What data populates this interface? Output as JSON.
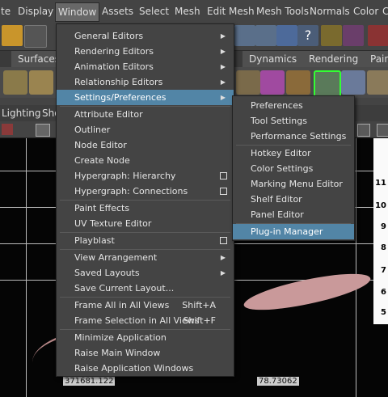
{
  "menubar": [
    "te",
    "Display",
    "Window",
    "Assets",
    "Select",
    "Mesh",
    "Edit Mesh",
    "Mesh Tools",
    "Normals",
    "Color",
    "C"
  ],
  "shelf_tabs": [
    "Surfaces",
    "Dynamics",
    "Rendering",
    "PaintE"
  ],
  "panel_menu": [
    "Lighting",
    "Sho"
  ],
  "window_menu": {
    "items": [
      {
        "label": "General Editors",
        "submenu": true
      },
      {
        "label": "Rendering Editors",
        "submenu": true
      },
      {
        "label": "Animation Editors",
        "submenu": true
      },
      {
        "label": "Relationship Editors",
        "submenu": true
      },
      {
        "label": "Settings/Preferences",
        "submenu": true,
        "highlighted": true
      },
      {
        "label": "Attribute Editor"
      },
      {
        "label": "Outliner"
      },
      {
        "label": "Node Editor"
      },
      {
        "label": "Create Node"
      },
      {
        "label": "Hypergraph: Hierarchy",
        "option": true
      },
      {
        "label": "Hypergraph: Connections",
        "option": true
      },
      {
        "label": "Paint Effects"
      },
      {
        "label": "UV Texture Editor"
      },
      {
        "label": "Playblast",
        "option": true
      },
      {
        "label": "View Arrangement",
        "submenu": true
      },
      {
        "label": "Saved Layouts",
        "submenu": true
      },
      {
        "label": "Save Current Layout..."
      },
      {
        "label": "Frame All in All Views",
        "shortcut": "Shift+A"
      },
      {
        "label": "Frame Selection in All Views",
        "shortcut": "Shift+F"
      },
      {
        "label": "Minimize Application"
      },
      {
        "label": "Raise Main Window"
      },
      {
        "label": "Raise Application Windows"
      }
    ]
  },
  "settings_submenu": {
    "items": [
      {
        "label": "Preferences"
      },
      {
        "label": "Tool Settings"
      },
      {
        "label": "Performance Settings"
      },
      {
        "label": "Hotkey Editor"
      },
      {
        "label": "Color Settings"
      },
      {
        "label": "Marking Menu Editor"
      },
      {
        "label": "Shelf Editor"
      },
      {
        "label": "Panel Editor"
      },
      {
        "label": "Plug-in Manager",
        "highlighted": true
      }
    ]
  },
  "viewport": {
    "ruler_numbers": [
      "11",
      "10",
      "9",
      "8",
      "7",
      "6",
      "5"
    ],
    "coord_left": "371681.122",
    "coord_right": "78.73062"
  },
  "colors": {
    "highlight": "#5285a6",
    "menu_bg": "#444444",
    "active_menu": "#686868"
  }
}
